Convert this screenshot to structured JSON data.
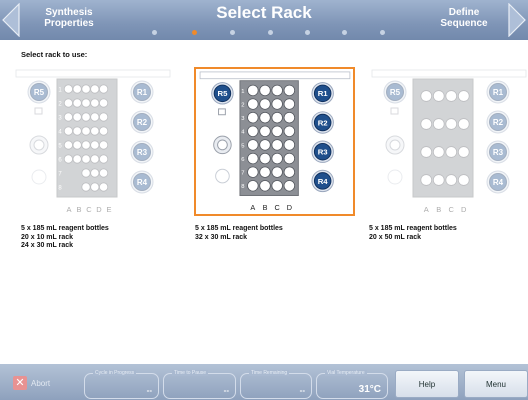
{
  "header": {
    "back_label_line1": "Synthesis",
    "back_label_line2": "Properties",
    "title": "Select Rack",
    "next_label_line1": "Define",
    "next_label_line2": "Sequence",
    "steps_total": 9,
    "active_step": 2,
    "accent_color": "#f08a2a"
  },
  "instruction": "Select rack to use:",
  "racks": [
    {
      "state": "dimmed",
      "lines": [
        "5 x 185 mL reagent bottles",
        "20 x 10 mL rack",
        "24 x 30 mL rack"
      ],
      "bottles": [
        "R5",
        "R1",
        "R2",
        "R3",
        "R4"
      ],
      "row_labels": [
        "1",
        "2",
        "3",
        "4",
        "5",
        "6",
        "7",
        "8"
      ],
      "col_labels": [
        "A",
        "B",
        "C",
        "D",
        "E"
      ]
    },
    {
      "state": "selected",
      "lines": [
        "5 x 185 mL reagent bottles",
        "32 x 30 mL rack"
      ],
      "bottles": [
        "R5",
        "R1",
        "R2",
        "R3",
        "R4"
      ],
      "row_labels": [
        "1",
        "2",
        "3",
        "4",
        "5",
        "6",
        "7",
        "8"
      ],
      "col_labels": [
        "A",
        "B",
        "C",
        "D"
      ]
    },
    {
      "state": "dimmed",
      "lines": [
        "5 x 185 mL reagent bottles",
        "20 x 50 mL rack"
      ],
      "bottles": [
        "R5",
        "R1",
        "R2",
        "R3",
        "R4"
      ],
      "row_labels": [],
      "col_labels": [
        "A",
        "B",
        "C",
        "D"
      ]
    }
  ],
  "toolbar": {
    "abort_label": "Abort",
    "cycle_label": "Cycle in Progress",
    "cycle_value": "--",
    "pause_label": "Time to Pause",
    "pause_value": "--",
    "remaining_label": "Time Remaining",
    "remaining_value": "--",
    "temp_label": "Vial Temperature",
    "temp_value": "31°C",
    "help_label": "Help",
    "menu_label": "Menu"
  }
}
